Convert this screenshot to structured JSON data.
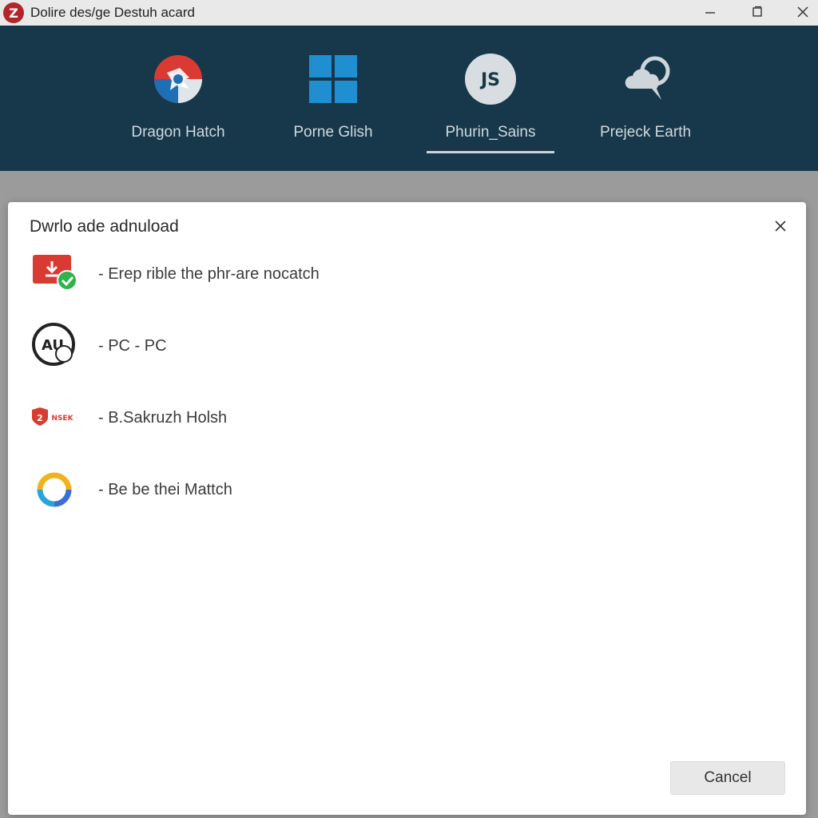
{
  "window": {
    "title": "Dolire des/ge Destuh acard",
    "app_icon_letter": "Z"
  },
  "nav": {
    "items": [
      {
        "label": "Dragon Hatch",
        "icon": "dragon-hatch-icon"
      },
      {
        "label": "Porne Glish",
        "icon": "windows-logo-icon"
      },
      {
        "label": "Phurin_Sains",
        "icon": "js-badge-icon",
        "badge_text": "JS",
        "selected": true
      },
      {
        "label": "Prejeck Earth",
        "icon": "cloud-shield-icon"
      }
    ]
  },
  "dialog": {
    "title": "Dwrlo ade adnuload",
    "items": [
      {
        "label": "- Erep rible the phr-are nocatch",
        "icon": "download-check-icon"
      },
      {
        "label": "- PC - PC",
        "icon": "au-badge-icon",
        "badge_text": "AU"
      },
      {
        "label": "- B.Sakruzh Holsh",
        "icon": "shield-logo-icon",
        "badge_text": "NSEK"
      },
      {
        "label": "- Be be thei Mattch",
        "icon": "ring-logo-icon"
      }
    ],
    "cancel_label": "Cancel"
  },
  "colors": {
    "titlebar_bg": "#e9e9e9",
    "nav_bg": "#17374a",
    "backdrop": "#9b9b9b",
    "dialog_bg": "#ffffff",
    "accent_red": "#d93a32",
    "accent_green": "#2fb34a",
    "windows_blue": "#1f8fd1"
  }
}
